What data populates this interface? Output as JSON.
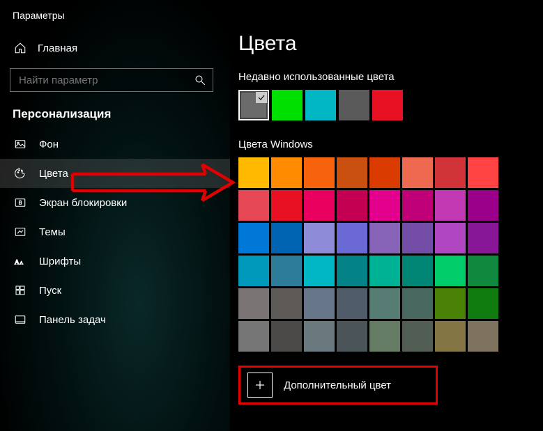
{
  "app_title": "Параметры",
  "sidebar": {
    "home_label": "Главная",
    "search_placeholder": "Найти параметр",
    "section_header": "Персонализация",
    "items": [
      {
        "label": "Фон",
        "icon": "image-icon"
      },
      {
        "label": "Цвета",
        "icon": "palette-icon"
      },
      {
        "label": "Экран блокировки",
        "icon": "lockscreen-icon"
      },
      {
        "label": "Темы",
        "icon": "theme-icon"
      },
      {
        "label": "Шрифты",
        "icon": "font-icon"
      },
      {
        "label": "Пуск",
        "icon": "start-icon"
      },
      {
        "label": "Панель задач",
        "icon": "taskbar-icon"
      }
    ],
    "active_index": 1
  },
  "main": {
    "title": "Цвета",
    "recent_header": "Недавно использованные цвета",
    "recent_colors": [
      {
        "hex": "#6b6b6b",
        "selected": true
      },
      {
        "hex": "#00e000"
      },
      {
        "hex": "#00b7c3"
      },
      {
        "hex": "#5a5a5a"
      },
      {
        "hex": "#e81123"
      }
    ],
    "windows_header": "Цвета Windows",
    "windows_colors": [
      "#ffb900",
      "#ff8c00",
      "#f7630c",
      "#ca5010",
      "#da3b01",
      "#ef6950",
      "#d13438",
      "#ff4343",
      "#e74856",
      "#e81123",
      "#ea005e",
      "#c30052",
      "#e3008c",
      "#bf0077",
      "#c239b3",
      "#9a0089",
      "#0078d7",
      "#0063b1",
      "#8e8cd8",
      "#6b69d6",
      "#8764b8",
      "#744da9",
      "#b146c2",
      "#881798",
      "#0099bc",
      "#2d7d9a",
      "#00b7c3",
      "#038387",
      "#00b294",
      "#018574",
      "#00cc6a",
      "#10893e",
      "#7a7574",
      "#5d5a58",
      "#68768a",
      "#515c6b",
      "#567c73",
      "#486860",
      "#498205",
      "#107c10",
      "#767676",
      "#4c4a48",
      "#69797e",
      "#4a5459",
      "#647c64",
      "#525e54",
      "#847545",
      "#7e735f"
    ],
    "custom_button_label": "Дополнительный цвет"
  }
}
